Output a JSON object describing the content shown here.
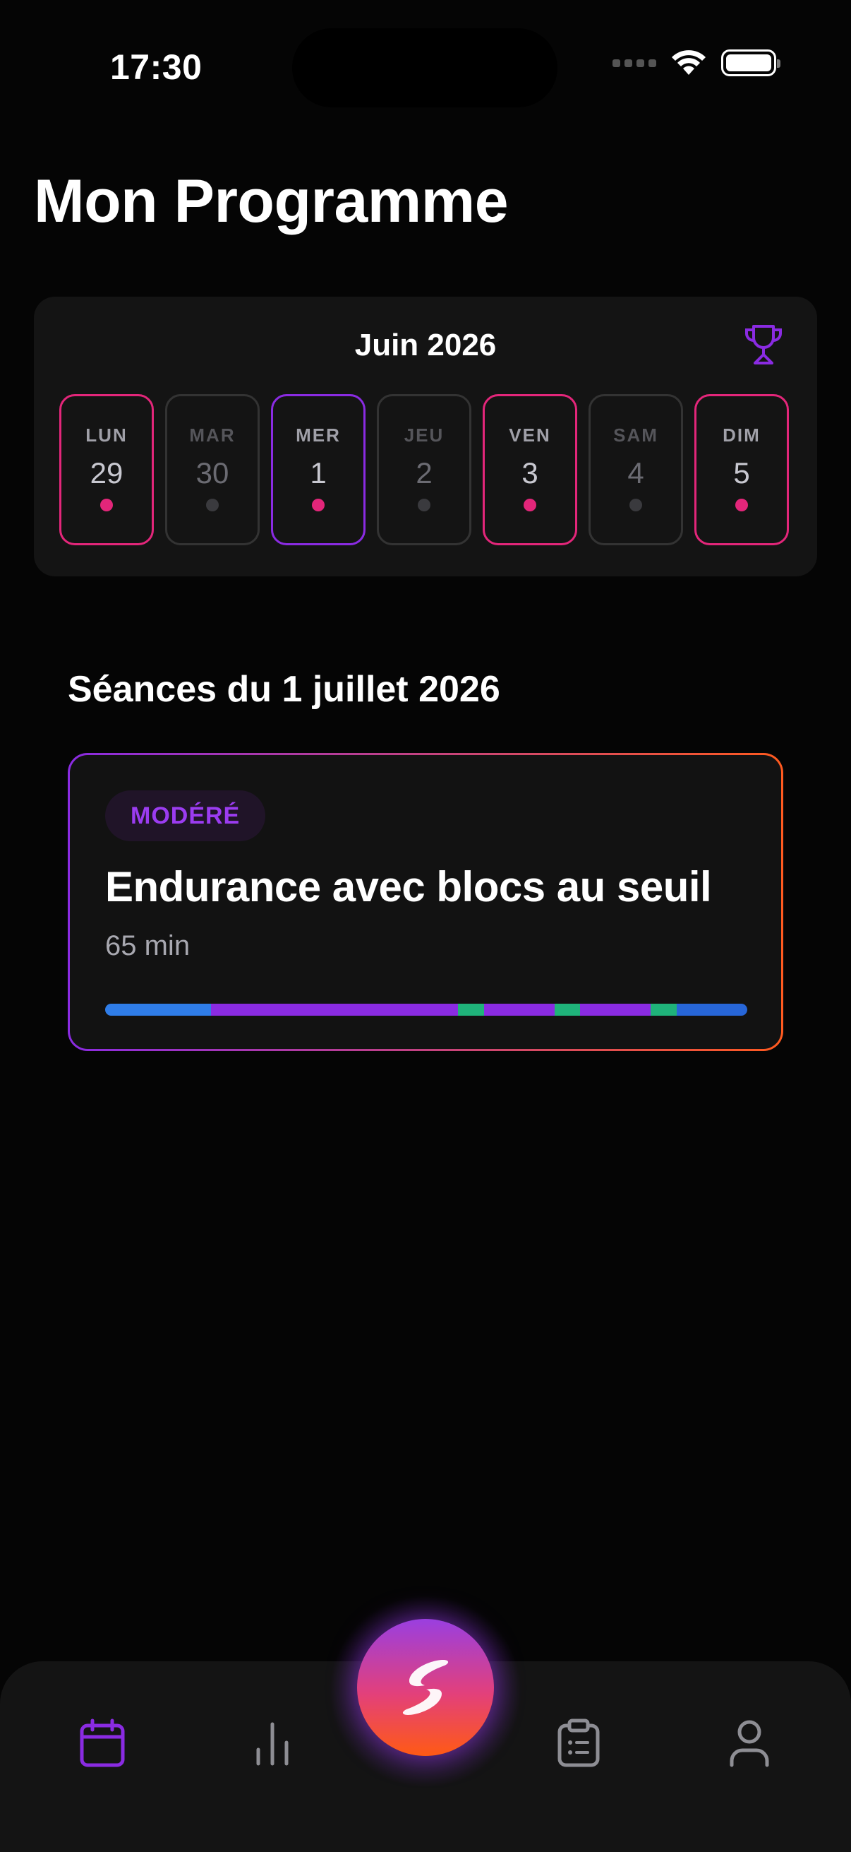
{
  "status_bar": {
    "time": "17:30"
  },
  "page": {
    "title": "Mon Programme"
  },
  "calendar": {
    "month": "Juin 2026",
    "days": [
      {
        "name": "LUN",
        "number": "29",
        "state": "planned"
      },
      {
        "name": "MAR",
        "number": "30",
        "state": "rest"
      },
      {
        "name": "MER",
        "number": "1",
        "state": "selected"
      },
      {
        "name": "JEU",
        "number": "2",
        "state": "rest"
      },
      {
        "name": "VEN",
        "number": "3",
        "state": "planned"
      },
      {
        "name": "SAM",
        "number": "4",
        "state": "rest"
      },
      {
        "name": "DIM",
        "number": "5",
        "state": "planned"
      }
    ]
  },
  "sessions": {
    "title": "Séances du 1 juillet 2026",
    "items": [
      {
        "intensity": "MODÉRÉ",
        "name": "Endurance avec blocs au seuil",
        "duration": "65 min",
        "zones": [
          {
            "zone": "warmup",
            "share": 0.165,
            "color": "#2f7de8"
          },
          {
            "zone": "endurance",
            "share": 0.385,
            "color": "#8a2be2"
          },
          {
            "zone": "threshold",
            "share": 0.04,
            "color": "#1fb37a"
          },
          {
            "zone": "endurance",
            "share": 0.11,
            "color": "#8a2be2"
          },
          {
            "zone": "threshold",
            "share": 0.04,
            "color": "#1fb37a"
          },
          {
            "zone": "endurance",
            "share": 0.11,
            "color": "#8a2be2"
          },
          {
            "zone": "threshold",
            "share": 0.04,
            "color": "#1fb37a"
          },
          {
            "zone": "cooldown",
            "share": 0.11,
            "color": "#2766d8"
          }
        ]
      }
    ]
  },
  "tab_bar": {
    "tabs": [
      {
        "id": "calendar",
        "icon": "calendar-icon",
        "active": true
      },
      {
        "id": "stats",
        "icon": "bar-chart-icon",
        "active": false
      },
      {
        "id": "plans",
        "icon": "clipboard-icon",
        "active": false
      },
      {
        "id": "profile",
        "icon": "user-icon",
        "active": false
      }
    ],
    "center_action_icon": "logo-icon"
  },
  "colors": {
    "accent": "#8a2be2",
    "planned": "#e3267a",
    "card_bg": "#141414",
    "background": "#050505"
  }
}
